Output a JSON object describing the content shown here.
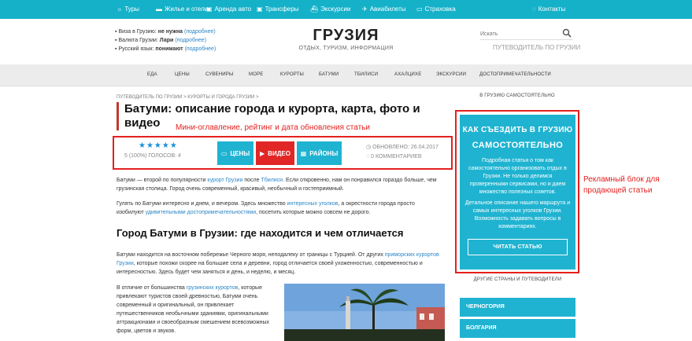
{
  "topbar": {
    "items": [
      {
        "label": "Туры",
        "icon": "sun-icon"
      },
      {
        "label": "Жилье и отели",
        "icon": "bed-icon"
      },
      {
        "label": "Аренда авто",
        "icon": "car-icon"
      },
      {
        "label": "Трансферы",
        "icon": "taxi-icon"
      },
      {
        "label": "Экскурсии",
        "icon": "ship-icon"
      },
      {
        "label": "Авиабилеты",
        "icon": "plane-icon"
      },
      {
        "label": "Страховка",
        "icon": "credit-card-icon"
      },
      {
        "label": "Контакты",
        "icon": "chat-icon"
      }
    ]
  },
  "header": {
    "info": [
      {
        "label": "Виза в Грузию:",
        "value": "не нужна",
        "link": "(подробнее)"
      },
      {
        "label": "Валюта Грузии:",
        "value": "Лари",
        "link": "(подробнее)"
      },
      {
        "label": "Русский язык:",
        "value": "понимают",
        "link": "(подробнее)"
      }
    ],
    "title": "ГРУЗИЯ",
    "subtitle": "ОТДЫХ, ТУРИЗМ, ИНФОРМАЦИЯ",
    "search_placeholder": "Искать",
    "guide_link": "ПУТЕВОДИТЕЛЬ ПО ГРУЗИИ"
  },
  "nav": [
    "ЕДА",
    "ЦЕНЫ",
    "СУВЕНИРЫ",
    "МОРЕ",
    "КУРОРТЫ",
    "БАТУМИ",
    "ТБИЛИСИ",
    "АХАЛЦИХЕ",
    "ЭКСКУРСИИ",
    "ДОСТОПРИМЕЧАТЕЛЬНОСТИ"
  ],
  "article": {
    "breadcrumb": "ПУТЕВОДИТЕЛЬ ПО ГРУЗИИ > КУРОРТЫ И ГОРОДА ГРУЗИИ >",
    "title": "Батуми: описание города и курорта, карта, фото и видео",
    "annotation_toc": "Мини-оглавление, рейтинг и дата обновления статьи",
    "rating": {
      "stars": "★★★★★",
      "votes": "5 (100%) ГОЛОСОВ: 4"
    },
    "buttons": {
      "prices": "ЦЕНЫ",
      "video": "ВИДЕО",
      "districts": "РАЙОНЫ"
    },
    "updated": "ОБНОВЛЕНО: 26.04.2017",
    "comments": "0 КОММЕНТАРИЕВ",
    "p1": {
      "a": "Батуми — второй по популярности ",
      "link1": "курорт Грузии",
      "b": " после ",
      "link2": "Тбилиси",
      "c": ". Если откровенно, нам он понравился гораздо больше, чем грузинская столица. Город очень современный, красивый, необычный и гостеприимный."
    },
    "p2": {
      "a": "Гулять по Батуми интересно и днем, и вечером. Здесь множество ",
      "link1": "интересных уголков",
      "b": ", а окрестности города просто изобилуют ",
      "link2": "удивительными достопримечательностями",
      "c": ", посетить которые можно совсем не дорого."
    },
    "h2": "Город Батуми в Грузии: где находится и чем отличается",
    "p3": {
      "a": "Батуми находится на восточном побережье Черного моря, неподалеку от границы с Турцией. От других ",
      "link1": "приморских курортов Грузии",
      "b": ", которые похожи скорее на большие села и деревни, город отличается своей ухоженностью, современностью и интересностью. Здесь будет чем заняться и день, и неделю, и месяц."
    },
    "p4": {
      "a": "В отличие от большинства ",
      "link1": "грузинских курортов",
      "b": ", которые привлекают туристов своей древностью, Батуми очень современный и оригинальный, он привлекает путешественников необычными зданиями, оригинальными аттракционами и своеобразным смешением всевозможных форм, цветов и звуков."
    }
  },
  "sidebar": {
    "head": "В ГРУЗИЮ САМОСТОЯТЕЛЬНО",
    "ad": {
      "title1": "КАК СЪЕЗДИТЬ В ГРУЗИЮ",
      "title2": "САМОСТОЯТЕЛЬНО",
      "p1": "Подробная статья о том как самостоятельно организовать отдых в Грузии. Не только делимся проверенными сервисами, но и даем множество полезных советов.",
      "p2": "Детальное описание нашего маршрута и самых интересных уголков Грузии. Возможность задавать вопросы в комментариях.",
      "button": "ЧИТАТЬ СТАТЬЮ"
    },
    "annotation_ad": "Рекламный блок для продающей статьи",
    "other_head": "ДРУГИЕ СТРАНЫ И ПУТЕВОДИТЕЛИ",
    "countries": [
      "ЧЕРНОГОРИЯ",
      "БОЛГАРИЯ"
    ]
  },
  "colors": {
    "accent": "#14b1c9",
    "annotation": "#e4201e",
    "video_button": "#e12626"
  }
}
